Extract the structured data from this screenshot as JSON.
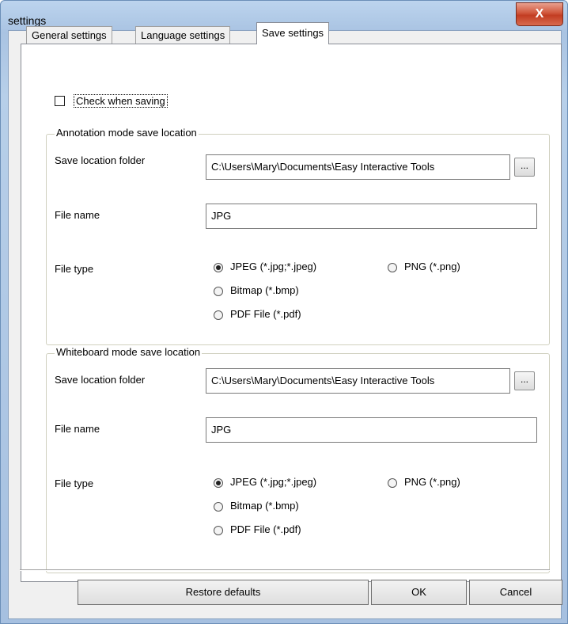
{
  "window": {
    "title": "settings",
    "close_label": "X"
  },
  "tabs": [
    {
      "label": "General settings",
      "active": false
    },
    {
      "label": "Language settings",
      "active": false
    },
    {
      "label": "Save settings",
      "active": true
    }
  ],
  "check_when_saving": {
    "label": "Check when saving",
    "checked": false
  },
  "annotation": {
    "legend": "Annotation mode save location",
    "folder_label": "Save location folder",
    "folder_value": "C:\\Users\\Mary\\Documents\\Easy Interactive Tools",
    "browse_label": "...",
    "filename_label": "File name",
    "filename_value": "JPG",
    "filetype_label": "File type",
    "filetypes": [
      "JPEG (*.jpg;*.jpeg)",
      "PNG (*.png)",
      "Bitmap (*.bmp)",
      "PDF File (*.pdf)"
    ],
    "selected_filetype": "JPEG (*.jpg;*.jpeg)"
  },
  "whiteboard": {
    "legend": "Whiteboard mode save location",
    "folder_label": "Save location folder",
    "folder_value": "C:\\Users\\Mary\\Documents\\Easy Interactive Tools",
    "browse_label": "...",
    "filename_label": "File name",
    "filename_value": "JPG",
    "filetype_label": "File type",
    "filetypes": [
      "JPEG (*.jpg;*.jpeg)",
      "PNG (*.png)",
      "Bitmap (*.bmp)",
      "PDF File (*.pdf)"
    ],
    "selected_filetype": "JPEG (*.jpg;*.jpeg)"
  },
  "buttons": {
    "restore": "Restore defaults",
    "ok": "OK",
    "cancel": "Cancel"
  }
}
